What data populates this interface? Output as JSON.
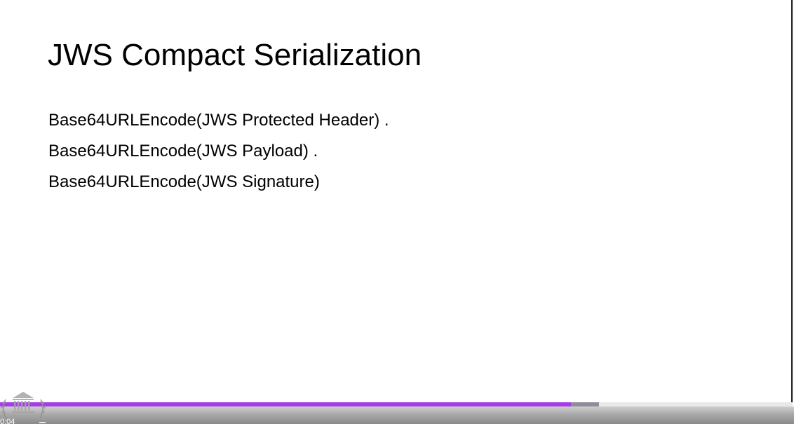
{
  "slide": {
    "title": "JWS Compact Serialization",
    "lines": [
      "Base64URLEncode(JWS Protected Header) .",
      "Base64URLEncode(JWS Payload) .",
      "Base64URLEncode(JWS Signature)"
    ]
  },
  "player": {
    "progress_fraction": 0.72,
    "buffered_fraction": 0.756,
    "time_text": "0:04",
    "colors": {
      "progress": "#a43ee6",
      "buffer": "#8e8e9a",
      "track": "#e9e9e9"
    },
    "icons": {
      "watermark": "institution-seal-icon",
      "menu": "menu-icon"
    }
  }
}
